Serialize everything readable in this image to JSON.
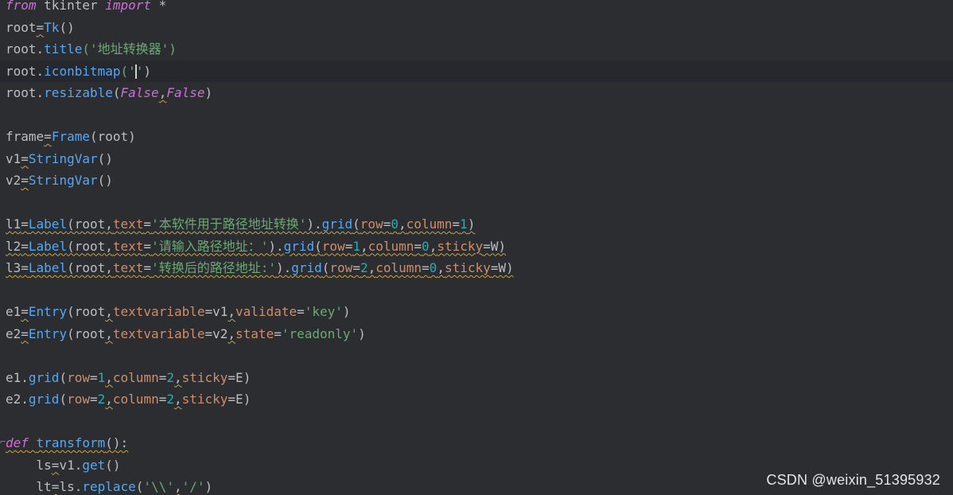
{
  "editor": {
    "lines": [
      [
        "from",
        " tkinter ",
        "import",
        " *"
      ],
      [
        "root",
        "=",
        "Tk",
        "()"
      ],
      [
        "root.",
        "title",
        "('",
        "地址转换器",
        "')"
      ],
      [
        "root.",
        "iconbitmap",
        "('",
        "'",
        ")"
      ],
      [
        "root.",
        "resizable",
        "(",
        "False",
        ",",
        "False",
        ")"
      ],
      [
        ""
      ],
      [
        "frame",
        "=",
        "Frame",
        "(root)"
      ],
      [
        "v1",
        "=",
        "StringVar",
        "()"
      ],
      [
        "v2",
        "=",
        "StringVar",
        "()"
      ],
      [
        ""
      ],
      [
        "l1",
        "=",
        "Label",
        "(root",
        ",",
        "text",
        "=",
        "'本软件用于路径地址转换'",
        ").",
        "grid",
        "(",
        "row",
        "=",
        "0",
        ",",
        "column",
        "=",
        "1",
        ")"
      ],
      [
        "l2",
        "=",
        "Label",
        "(root",
        ",",
        "text",
        "=",
        "'请输入路径地址：'",
        ").",
        "grid",
        "(",
        "row",
        "=",
        "1",
        ",",
        "column",
        "=",
        "0",
        ",",
        "sticky",
        "=W)"
      ],
      [
        "l3",
        "=",
        "Label",
        "(root",
        ",",
        "text",
        "=",
        "'转换后的路径地址:'",
        ").",
        "grid",
        "(",
        "row",
        "=",
        "2",
        ",",
        "column",
        "=",
        "0",
        ",",
        "sticky",
        "=W)"
      ],
      [
        ""
      ],
      [
        "e1",
        "=",
        "Entry",
        "(root",
        ",",
        "textvariable",
        "=v1",
        ",",
        "validate",
        "=",
        "'key'",
        ")"
      ],
      [
        "e2",
        "=",
        "Entry",
        "(root",
        ",",
        "textvariable",
        "=v2",
        ",",
        "state",
        "=",
        "'readonly'",
        ")"
      ],
      [
        ""
      ],
      [
        "e1.",
        "grid",
        "(",
        "row",
        "=",
        "1",
        ",",
        "column",
        "=",
        "2",
        ",",
        "sticky",
        "=E)"
      ],
      [
        "e2.",
        "grid",
        "(",
        "row",
        "=",
        "2",
        ",",
        "column",
        "=",
        "2",
        ",",
        "sticky",
        "=E)"
      ],
      [
        ""
      ],
      [
        "def",
        " ",
        "transform",
        "():"
      ],
      [
        "    ls",
        "=",
        "v1.",
        "get",
        "()"
      ],
      [
        "    lt",
        "=",
        "ls.",
        "replace",
        "(",
        "'\\\\'",
        ",",
        "'/'",
        ")"
      ]
    ]
  },
  "watermark": "CSDN @weixin_51395932",
  "colors": {
    "background": "#2b2d30",
    "keyword": "#cf8e6d",
    "function": "#56a8f5",
    "string": "#6aab73",
    "number": "#2aacb8",
    "italic_keyword": "#cf6dd9",
    "plain": "#bcbec4"
  }
}
